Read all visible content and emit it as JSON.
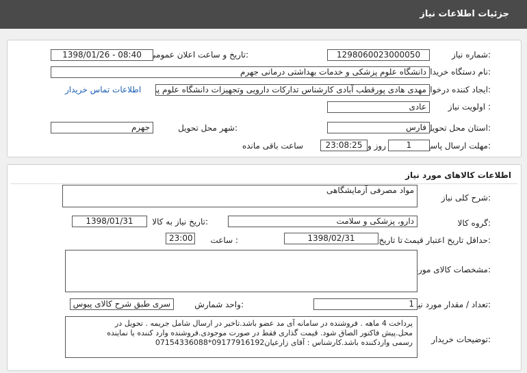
{
  "header": {
    "title": "جزئیات اطلاعات نیاز"
  },
  "info": {
    "need_number_label": "شماره نیاز:",
    "need_number": "1298060023000050",
    "announce_label": "تاریخ و ساعت اعلان عمومی:",
    "announce_value": "1398/01/26 - 08:40",
    "buyer_label": "نام دستگاه خریدار:",
    "buyer_value": "دانشگاه علوم پزشکی و خدمات بهداشتی درمانی جهرم",
    "requester_label": "ایجاد کننده درخواست:",
    "requester_value": "مهدی هادی پورقطب آبادی کارشناس تدارکات دارویی وتجهیزات دانشگاه علوم پز",
    "contact_link": "اطلاعات تماس خریدار",
    "priority_label": "اولویت نیاز :",
    "priority_value": "عادی",
    "province_label": "استان محل تحویل:",
    "province_value": "فارس",
    "city_label": "شهر محل تحویل:",
    "city_value": "جهرم",
    "deadline_label": "مهلت ارسال پاسخ:",
    "deadline_days": "1",
    "days_label": "روز و",
    "deadline_time": "23:08:25",
    "remaining_label": "ساعت باقی مانده"
  },
  "goods": {
    "section_title": "اطلاعات کالاهای مورد نیاز",
    "summary_label": "شرح کلی نیاز:",
    "summary_value": "مواد مصرفی آزمایشگاهی",
    "group_label": "گروه کالا:",
    "group_value": "دارو، پزشکی و سلامت",
    "need_date_label": "تاریخ نیاز به کالا:",
    "need_date_value": "1398/01/31",
    "min_price_label": "حداقل تاریخ اعتبار قیمت:",
    "until_date_label": "تا تاریخ :",
    "until_date_value": "1398/02/31",
    "hour_label": "ساعت :",
    "hour_value": "23:00",
    "specs_label": "مشخصات کالای مورد نیاز:",
    "qty_label": "تعداد / مقدار مورد نیاز:",
    "qty_value": "1",
    "unit_label": "واحد شمارش:",
    "unit_value": "سری طبق شرح کالای پیوس",
    "notes_label": "توضیحات خریدار:",
    "notes_line1": "پرداخت 4 ماهه . فروشنده در سامانه آی مد عضو باشد.تاخیر در ارسال شامل جریمه  . تحویل در",
    "notes_line2": "محل.پیش فاکتور الصاق شود. قیمت گذاری فقط در صورت موجودی.فروشنده وارد کننده یا نماینده",
    "notes_line3": "رسمی واردکننده باشد.کارشناس : آقای زارعیان09177916192*07154336088"
  }
}
